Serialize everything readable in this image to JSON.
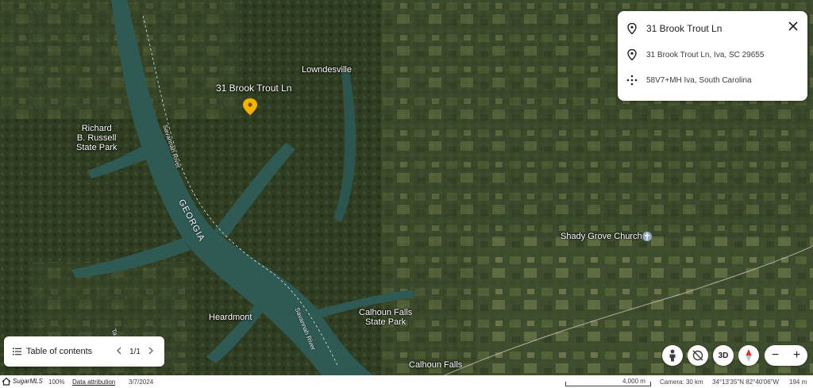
{
  "map": {
    "places": {
      "pin_label": "31 Brook Trout Ln",
      "lowndesville": "Lowndesville",
      "richard_russell": [
        "Richard",
        "B. Russell",
        "State Park"
      ],
      "shady_grove": "Shady Grove Church",
      "heardmont": "Heardmont",
      "calhoun_falls_park": [
        "Calhoun Falls",
        "State Park"
      ],
      "calhoun_falls": "Calhoun Falls",
      "state": "GEORGIA",
      "river_1": "Savannah River",
      "river_2": "Savannah River",
      "partial_label": "Ta"
    },
    "pin_color": "#f4b400"
  },
  "info_card": {
    "title": "31 Brook Trout Ln",
    "address": "31 Brook Trout Ln, Iva, SC 29655",
    "plus_code": "58V7+MH Iva, South Carolina"
  },
  "toc": {
    "label": "Table of contents",
    "page": "1/1"
  },
  "controls": {
    "threed": "3D",
    "zoom_out": "−",
    "zoom_in": "+"
  },
  "status": {
    "logo": "SugarMLS",
    "zoom": "100%",
    "attribution": "Data attribution",
    "date": "3/7/2024",
    "scale": "4,000 m",
    "camera": "Camera: 30 km",
    "coords": "34°13'35\"N 82°40'06\"W",
    "elevation": "194 m"
  }
}
